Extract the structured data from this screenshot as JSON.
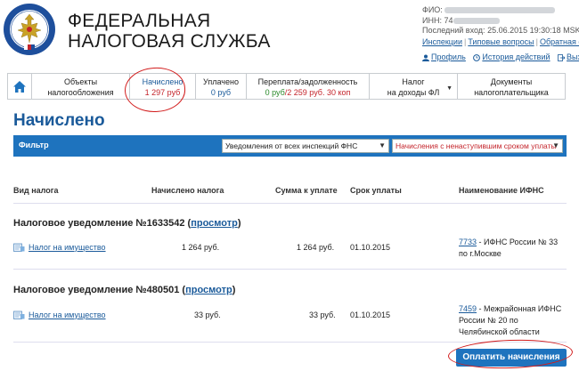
{
  "header": {
    "brand_line1": "ФЕДЕРАЛЬНАЯ",
    "brand_line2": "НАЛОГОВАЯ СЛУЖБА",
    "fio_label": "ФИО:",
    "inn_label": "ИНН:",
    "inn_visible": "74",
    "last_login_label": "Последний вход:",
    "last_login_value": "25.06.2015 19:30:18 MSK",
    "links": [
      "Инспекции",
      "Типовые вопросы",
      "Обратная связь"
    ],
    "profile_label": "Профиль",
    "history_label": "История действий",
    "logout_label": "Выход"
  },
  "tabs": [
    {
      "line1": "Объекты",
      "line2": "налогообложения"
    },
    {
      "line1": "Начислено",
      "line2": "1 297 руб"
    },
    {
      "line1": "Уплачено",
      "line2": "0 руб"
    },
    {
      "line1": "Переплата/задолженность",
      "line2a": "0 руб",
      "line2b": "/2 259 руб. 30 коп"
    },
    {
      "line1": "Налог",
      "line2": "на доходы ФЛ"
    },
    {
      "line1": "Документы",
      "line2": "налогоплательщика"
    }
  ],
  "page_title": "Начислено",
  "filter": {
    "label": "Фильтр",
    "select1": "Уведомления от всех инспекций ФНС",
    "select2": "Начисления с ненаступившим сроком уплаты"
  },
  "table": {
    "headers": {
      "type": "Вид налога",
      "accrued": "Начислено налога",
      "to_pay": "Сумма к уплате",
      "due": "Срок уплаты",
      "ifns": "Наименование ИФНС"
    },
    "groups": [
      {
        "title": "Налоговое уведомление №1633542",
        "link": "просмотр",
        "tax": "Налог на имущество",
        "accrued": "1 264 руб.",
        "to_pay": "1 264 руб.",
        "due": "01.10.2015",
        "ifns_code": "7733",
        "ifns_line1": " - ИФНС России № 33",
        "ifns_line2": "по г.Москве"
      },
      {
        "title": "Налоговое уведомление №480501",
        "link": "просмотр",
        "tax": "Налог на имущество",
        "accrued": "33 руб.",
        "to_pay": "33 руб.",
        "due": "01.10.2015",
        "ifns_code": "7459",
        "ifns_line1": " - Межрайонная ИФНС",
        "ifns_line2": "России № 20 по",
        "ifns_line3": "Челябинской области"
      }
    ]
  },
  "pay_button": "Оплатить начисления",
  "colors": {
    "accent": "#1e73be",
    "link": "#1a5a9a",
    "debt": "#c4242b",
    "annotation": "#d21c1c"
  }
}
